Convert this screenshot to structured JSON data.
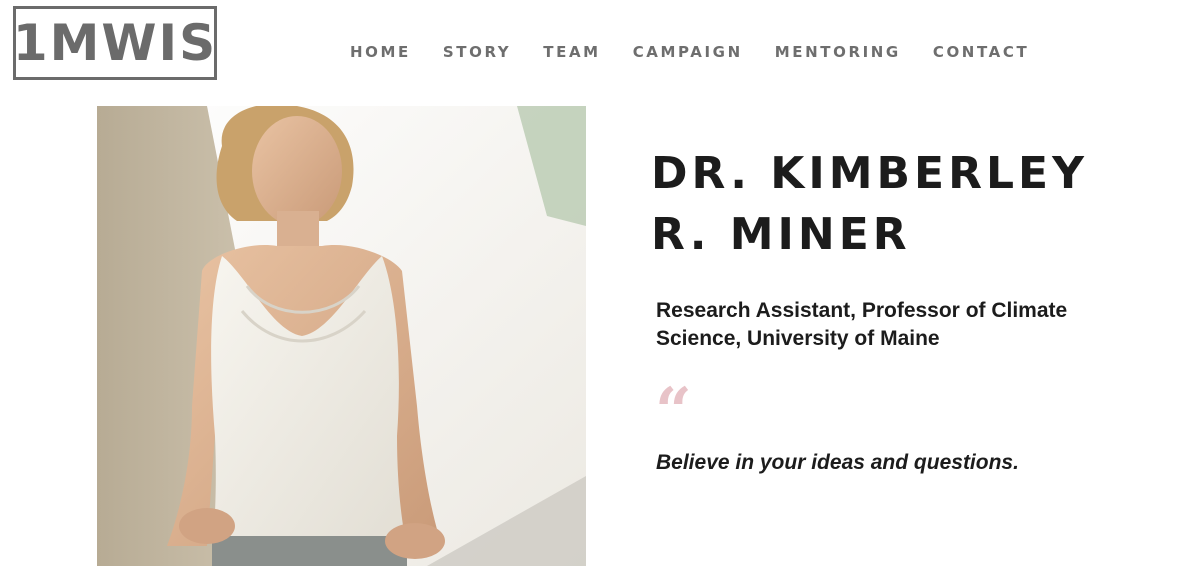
{
  "header": {
    "logo_text": "1MWIS"
  },
  "nav": {
    "items": [
      {
        "label": "HOME"
      },
      {
        "label": "STORY"
      },
      {
        "label": "TEAM"
      },
      {
        "label": "CAMPAIGN"
      },
      {
        "label": "MENTORING"
      },
      {
        "label": "CONTACT"
      }
    ]
  },
  "profile": {
    "name_line1": "DR. KIMBERLEY",
    "name_line2": "R. MINER",
    "role": "Research Assistant, Professor of Climate Science, University of Maine",
    "quote_mark": "“",
    "quote": "Believe in your ideas and questions."
  },
  "colors": {
    "nav_text": "#6e6e6e",
    "logo": "#6b6b6b",
    "heading": "#1c1c1c",
    "quote_mark": "#e8c3c8"
  }
}
